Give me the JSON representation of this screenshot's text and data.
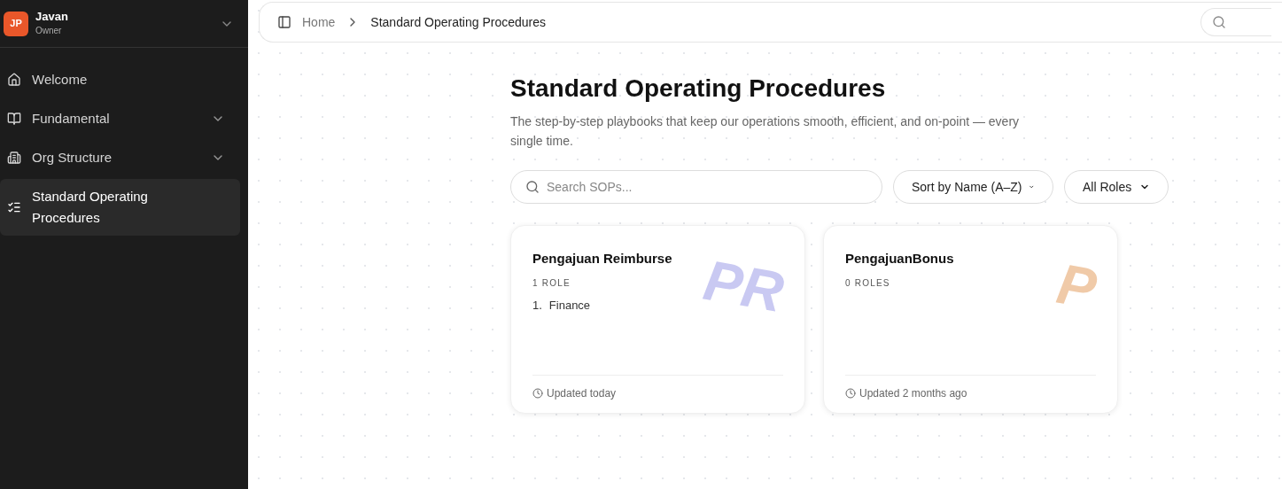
{
  "account": {
    "initials": "JP",
    "name": "Javan",
    "role": "Owner"
  },
  "sidebar": {
    "items": [
      {
        "label": "Welcome",
        "kind": "home",
        "expandable": false,
        "selected": false
      },
      {
        "label": "Fundamental",
        "kind": "book",
        "expandable": true,
        "selected": false
      },
      {
        "label": "Org Structure",
        "kind": "building",
        "expandable": true,
        "selected": false
      },
      {
        "label": "Standard Operating Procedures",
        "kind": "list",
        "expandable": false,
        "selected": true
      }
    ]
  },
  "breadcrumb": [
    "Home",
    "Standard Operating Procedures"
  ],
  "page": {
    "title": "Standard Operating Procedures",
    "description": "The step-by-step playbooks that keep our operations smooth, efficient, and on-point — every single time."
  },
  "filters": {
    "search_placeholder": "Search SOPs...",
    "sort": "Sort by Name (A–Z)",
    "role": "All Roles"
  },
  "cards": [
    {
      "title": "Pengajuan Reimburse",
      "monogram": "PR",
      "color": "#c9c9f2",
      "role_count": "1 ROLE",
      "roles": [
        {
          "number": "1.",
          "name": "Finance"
        }
      ],
      "updated": "Updated today"
    },
    {
      "title": "PengajuanBonus",
      "monogram": "P",
      "color": "#f0caa8",
      "role_count": "0 ROLES",
      "updated": "Updated 2 months ago"
    }
  ]
}
